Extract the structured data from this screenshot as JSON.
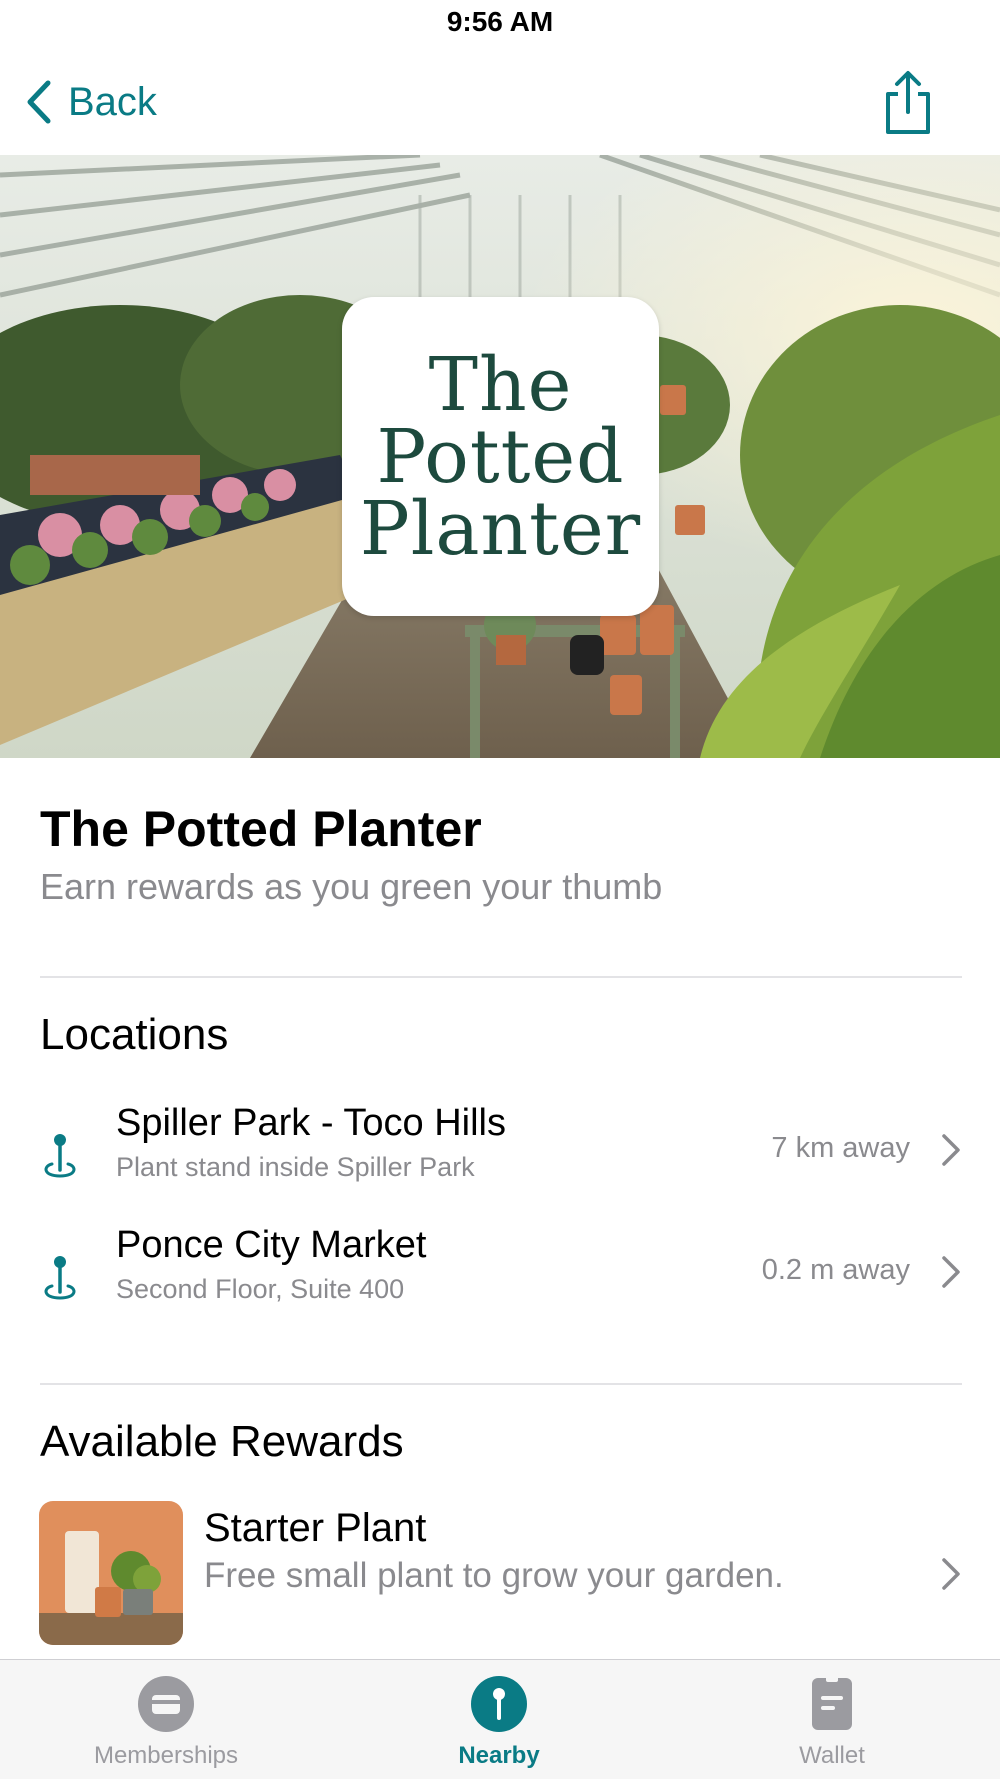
{
  "status_bar": {
    "time": "9:56 AM"
  },
  "nav": {
    "back_label": "Back",
    "share_icon": "share-icon"
  },
  "hero": {
    "logo_lines": [
      "The",
      "Potted",
      "Planter"
    ]
  },
  "business": {
    "name": "The Potted Planter",
    "tagline": "Earn rewards as you green your thumb"
  },
  "locations": {
    "heading": "Locations",
    "items": [
      {
        "name": "Spiller Park - Toco Hills",
        "description": "Plant stand inside Spiller Park",
        "distance": "7 km away"
      },
      {
        "name": "Ponce City Market",
        "description": "Second Floor, Suite 400",
        "distance": "0.2 m away"
      }
    ]
  },
  "rewards": {
    "heading": "Available Rewards",
    "items": [
      {
        "name": "Starter Plant",
        "description": "Free small plant to grow your garden."
      }
    ]
  },
  "tabs": [
    {
      "label": "Memberships",
      "icon": "card-icon",
      "active": false
    },
    {
      "label": "Nearby",
      "icon": "pin-icon",
      "active": true
    },
    {
      "label": "Wallet",
      "icon": "wallet-icon",
      "active": false
    }
  ],
  "colors": {
    "accent": "#0a7b85",
    "secondary_text": "#8a8a8e",
    "logo_green": "#1d4a3e"
  }
}
